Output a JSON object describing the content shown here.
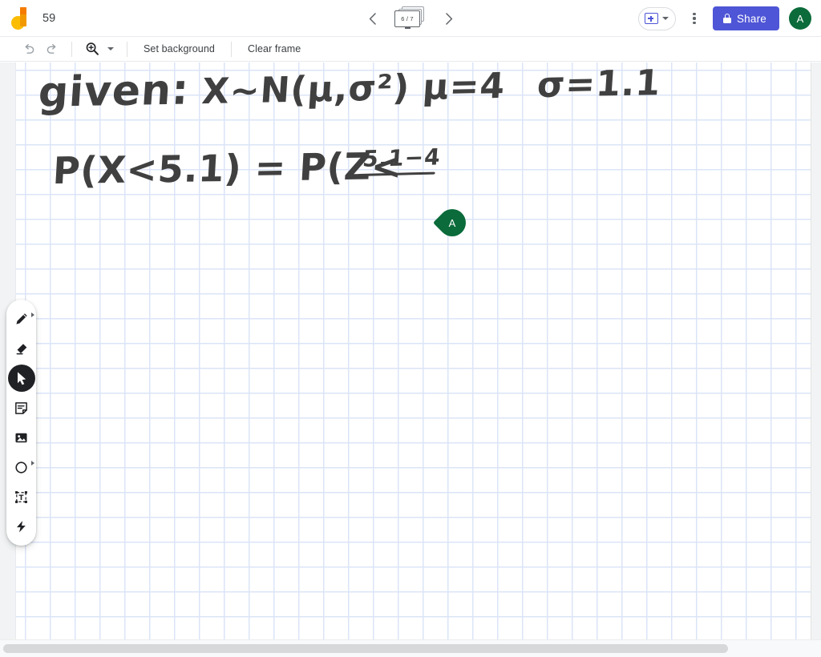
{
  "app": {
    "name": "Google Jamboard",
    "logo_icon": "jamboard-logo-icon",
    "document_title": "59"
  },
  "topbar": {
    "prev_frame_icon": "chevron-left-icon",
    "next_frame_icon": "chevron-right-icon",
    "frame_counter": "6 / 7",
    "frame_stack_icon": "frame-stack-icon",
    "add_frame_icon": "add-frame-icon",
    "add_frame_caret_icon": "chevron-down-icon",
    "more_options_icon": "kebab-menu-icon",
    "share_label": "Share",
    "share_lock_icon": "lock-icon",
    "share_color": "#4e55d6",
    "avatar_initial": "A",
    "avatar_color": "#0b6b3a"
  },
  "subtoolbar": {
    "undo_icon": "undo-icon",
    "redo_icon": "redo-icon",
    "zoom_icon": "zoom-in-magnifier-icon",
    "zoom_caret_icon": "chevron-down-icon",
    "set_background_label": "Set background",
    "clear_frame_label": "Clear frame"
  },
  "toolrail": {
    "items": [
      {
        "name": "pen",
        "icon": "pen-icon",
        "active": false,
        "has_submenu": true
      },
      {
        "name": "eraser",
        "icon": "eraser-icon",
        "active": false,
        "has_submenu": false
      },
      {
        "name": "select",
        "icon": "cursor-arrow-icon",
        "active": true,
        "has_submenu": false
      },
      {
        "name": "sticky-note",
        "icon": "sticky-note-icon",
        "active": false,
        "has_submenu": false
      },
      {
        "name": "image",
        "icon": "image-icon",
        "active": false,
        "has_submenu": false
      },
      {
        "name": "shape",
        "icon": "circle-shape-icon",
        "active": false,
        "has_submenu": true
      },
      {
        "name": "text-box",
        "icon": "text-box-icon",
        "active": false,
        "has_submenu": false
      },
      {
        "name": "laser",
        "icon": "laser-pointer-icon",
        "active": false,
        "has_submenu": false
      }
    ]
  },
  "canvas": {
    "background_style": "graph-paper-grid",
    "grid_color": "#dbe4f7",
    "ink_color": "#404040",
    "handwriting": {
      "line1_prefix": "given:",
      "line1_distribution": "X~N(μ,σ²)",
      "line1_mu": "μ=4",
      "line1_sigma": "σ=1.1",
      "line2_left": "P(X<5.1) = P(Z<",
      "fraction_numerator": "5.1−4"
    },
    "collaborator_pin": {
      "initial": "A",
      "color": "#0b6b3a"
    }
  },
  "scrollbar": {
    "orientation": "horizontal",
    "thumb_percent": 89
  }
}
